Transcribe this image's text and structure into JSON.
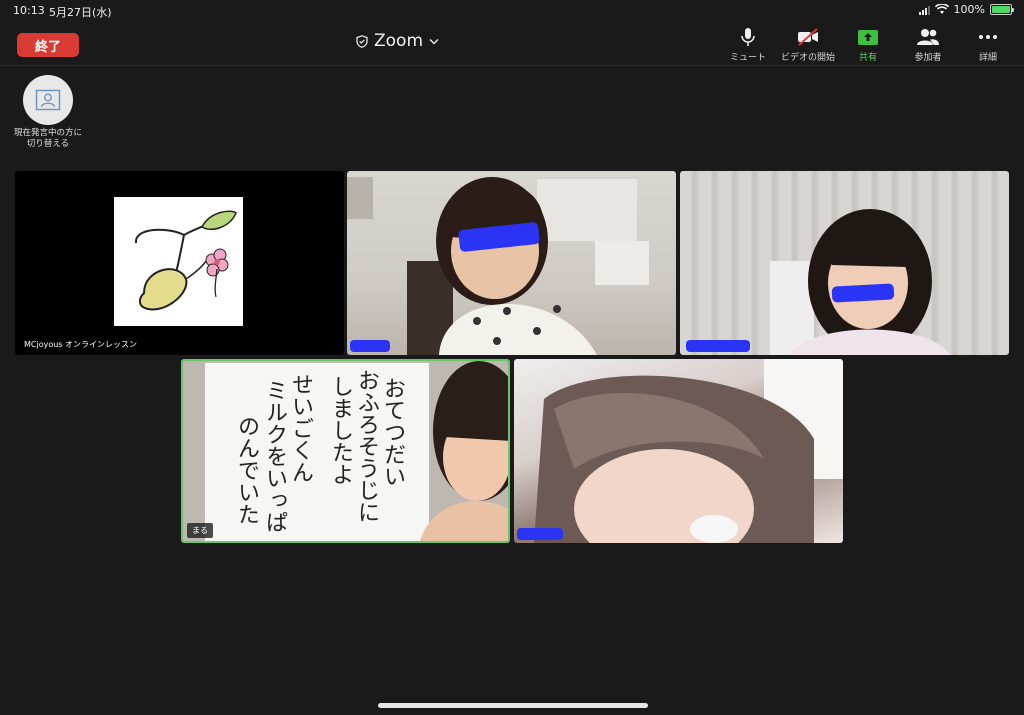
{
  "status_bar": {
    "time": "10:13",
    "date": "5月27日(水)",
    "battery": "100%"
  },
  "toolbar": {
    "end_label": "終了",
    "app_title": "Zoom",
    "tools": {
      "mute": "ミュート",
      "start_video": "ビデオの開始",
      "share": "共有",
      "participants": "参加者",
      "more": "詳細"
    }
  },
  "switch_view": {
    "label_line1": "現在発言中の方に",
    "label_line2": "切り替える"
  },
  "tiles": [
    {
      "name": "MCjoyous オンラインレッスン"
    },
    {
      "name": ""
    },
    {
      "name": ""
    },
    {
      "name": "まる",
      "board_lines": [
        "おてつだい",
        "おふろそうじに",
        "しましたよ",
        "せいごくん",
        "ミルクをいっぱ",
        "のんでいた"
      ]
    },
    {
      "name": ""
    }
  ],
  "colors": {
    "end_button": "#d93a33",
    "share_icon": "#3fbf3f",
    "active_border": "#6ac46a",
    "redaction": "#2b34f5"
  }
}
